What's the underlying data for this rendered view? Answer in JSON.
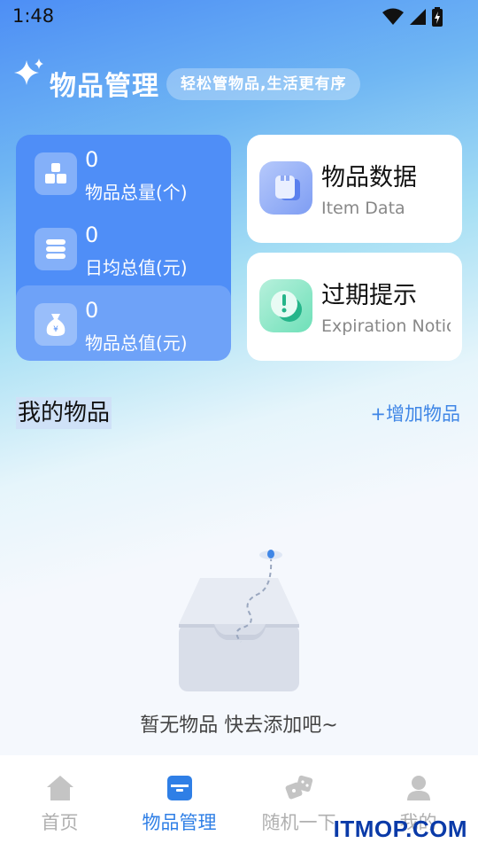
{
  "status_bar": {
    "time": "1:48"
  },
  "header": {
    "title": "物品管理",
    "slogan": "轻松管物品,生活更有序"
  },
  "stats": [
    {
      "value": "0",
      "label": "物品总量(个)",
      "icon": "boxes-icon"
    },
    {
      "value": "0",
      "label": "日均总值(元)",
      "icon": "layers-icon"
    },
    {
      "value": "0",
      "label": "物品总值(元)",
      "icon": "money-bag-icon"
    }
  ],
  "features": [
    {
      "title": "物品数据",
      "subtitle": "Item Data",
      "icon": "data-icon"
    },
    {
      "title": "过期提示",
      "subtitle": "Expiration Notice",
      "icon": "alert-icon"
    }
  ],
  "section": {
    "title": "我的物品",
    "add_label": "+增加物品"
  },
  "empty_state": {
    "text": "暂无物品 快去添加吧~"
  },
  "tabs": [
    {
      "label": "首页",
      "icon": "home-icon",
      "active": false
    },
    {
      "label": "物品管理",
      "icon": "box-icon",
      "active": true
    },
    {
      "label": "随机一下",
      "icon": "dice-icon",
      "active": false
    },
    {
      "label": "我的",
      "icon": "user-icon",
      "active": false
    }
  ],
  "watermark": "ITMOP.COM",
  "colors": {
    "primary": "#4f8ef7",
    "accent_link": "#3f86e6",
    "tab_active": "#2f7fe6",
    "tab_inactive": "#b0b0b0",
    "alert_green": "#3ccfa0"
  }
}
